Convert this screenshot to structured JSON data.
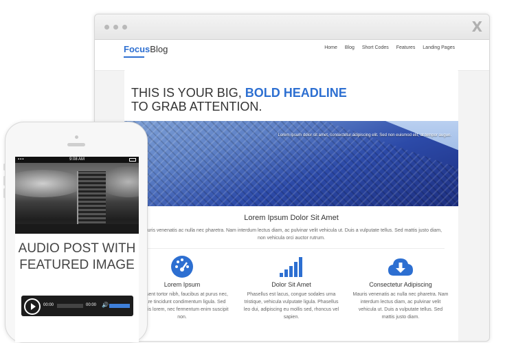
{
  "browser": {
    "close_glyph": "X"
  },
  "site": {
    "logo_part1": "Focus",
    "logo_part2": "Blog",
    "nav": [
      "Home",
      "Blog",
      "Short Codes",
      "Features",
      "Landing Pages"
    ],
    "headline_line1_plain": "THIS IS YOUR BIG, ",
    "headline_line1_bold": "BOLD HEADLINE",
    "headline_line2": "TO GRAB ATTENTION.",
    "hero_caption": "Lorem ipsum dolor sit amet, consectetur adipiscing elit. Sed non euismod elit, at tempor augue.",
    "section_title": "Lorem Ipsum Dolor Sit Amet",
    "section_text": "Mauris venenatis ac nulla nec pharetra. Nam interdum lectus diam, ac pulvinar velit vehicula ut. Duis a vulputate tellus. Sed mattis justo diam, non vehicula orci auctor rutrum.",
    "features": [
      {
        "icon": "dashboard-icon",
        "title": "Lorem Ipsum",
        "text": "Praesent tortor nibh, faucibus at purus nec, ornare tincidunt condimentum ligula. Sed lobortis lorem, nec fermentum enim suscipit non."
      },
      {
        "icon": "signal-bars-icon",
        "title": "Dolor Sit Amet",
        "text": "Phasellus est lacus, congue sodales urna tristique, vehicula vulputate ligula. Phasellus leo dui, adipiscing eu mollis sed, rhoncus vel sapien."
      },
      {
        "icon": "cloud-download-icon",
        "title": "Consectetur Adipiscing",
        "text": "Mauris venenatis ac nulla nec pharetra. Nam interdum lectus diam, ac pulvinar velit vehicula ut. Duis a vulputate tellus. Sed mattis justo diam."
      }
    ]
  },
  "phone": {
    "clock": "9:08 AM",
    "post_title": "AUDIO POST WITH FEATURED IMAGE",
    "player": {
      "time_elapsed": "00:00",
      "time_total": "00:00"
    }
  },
  "colors": {
    "accent": "#2d6fd1"
  }
}
